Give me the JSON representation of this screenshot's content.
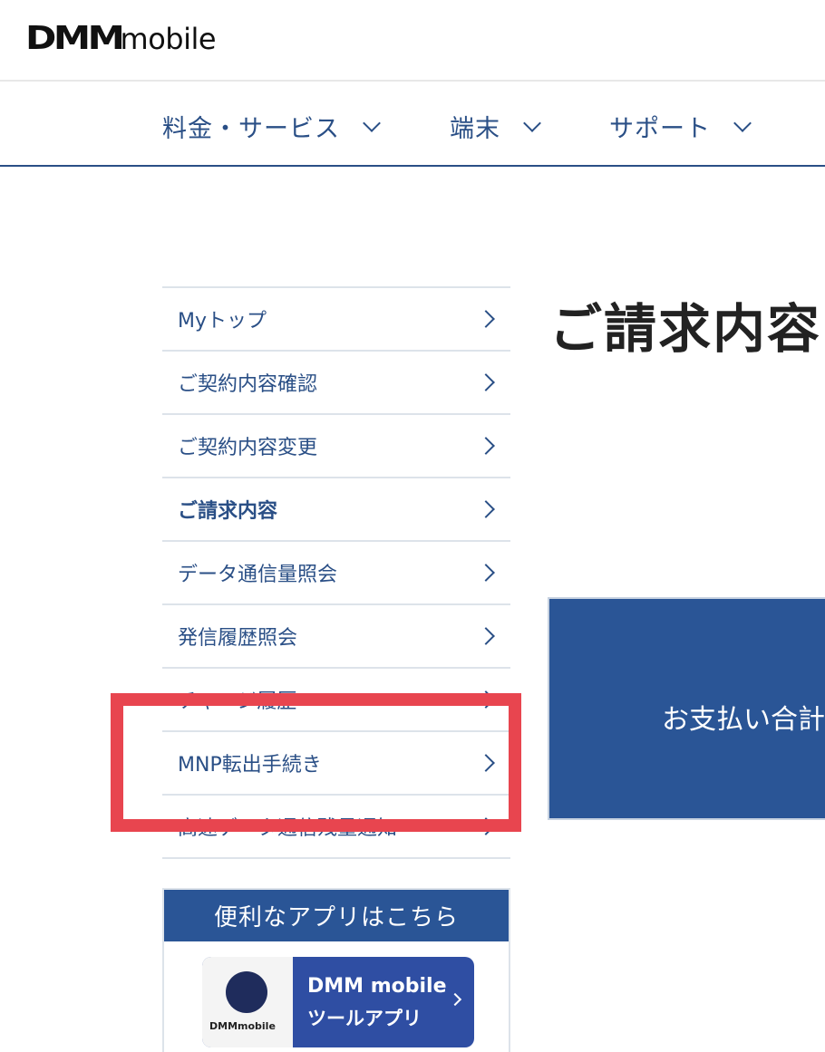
{
  "header": {
    "logo_main": "DMM",
    "logo_sub": "mobile"
  },
  "nav": {
    "items": [
      {
        "label": "料金・サービス"
      },
      {
        "label": "端末"
      },
      {
        "label": "サポート"
      }
    ]
  },
  "sidebar": {
    "items": [
      {
        "label": "Myトップ"
      },
      {
        "label": "ご契約内容確認"
      },
      {
        "label": "ご契約内容変更"
      },
      {
        "label": "ご請求内容",
        "active": true
      },
      {
        "label": "データ通信量照会"
      },
      {
        "label": "発信履歴照会"
      },
      {
        "label": "チャージ履歴"
      },
      {
        "label": "MNP転出手続き"
      },
      {
        "label": "高速データ通信残量通知"
      }
    ]
  },
  "main": {
    "title": "ご請求内容",
    "payment_label": "お支払い合計"
  },
  "apps": {
    "header": "便利なアプリはこちら",
    "banner_title": "DMM mobile",
    "banner_sub": "ツールアプリ",
    "icon_text": "DMMmobile"
  },
  "colors": {
    "brand_blue": "#2a5596",
    "text_blue": "#2a4f86",
    "highlight_red": "#e8454f"
  }
}
